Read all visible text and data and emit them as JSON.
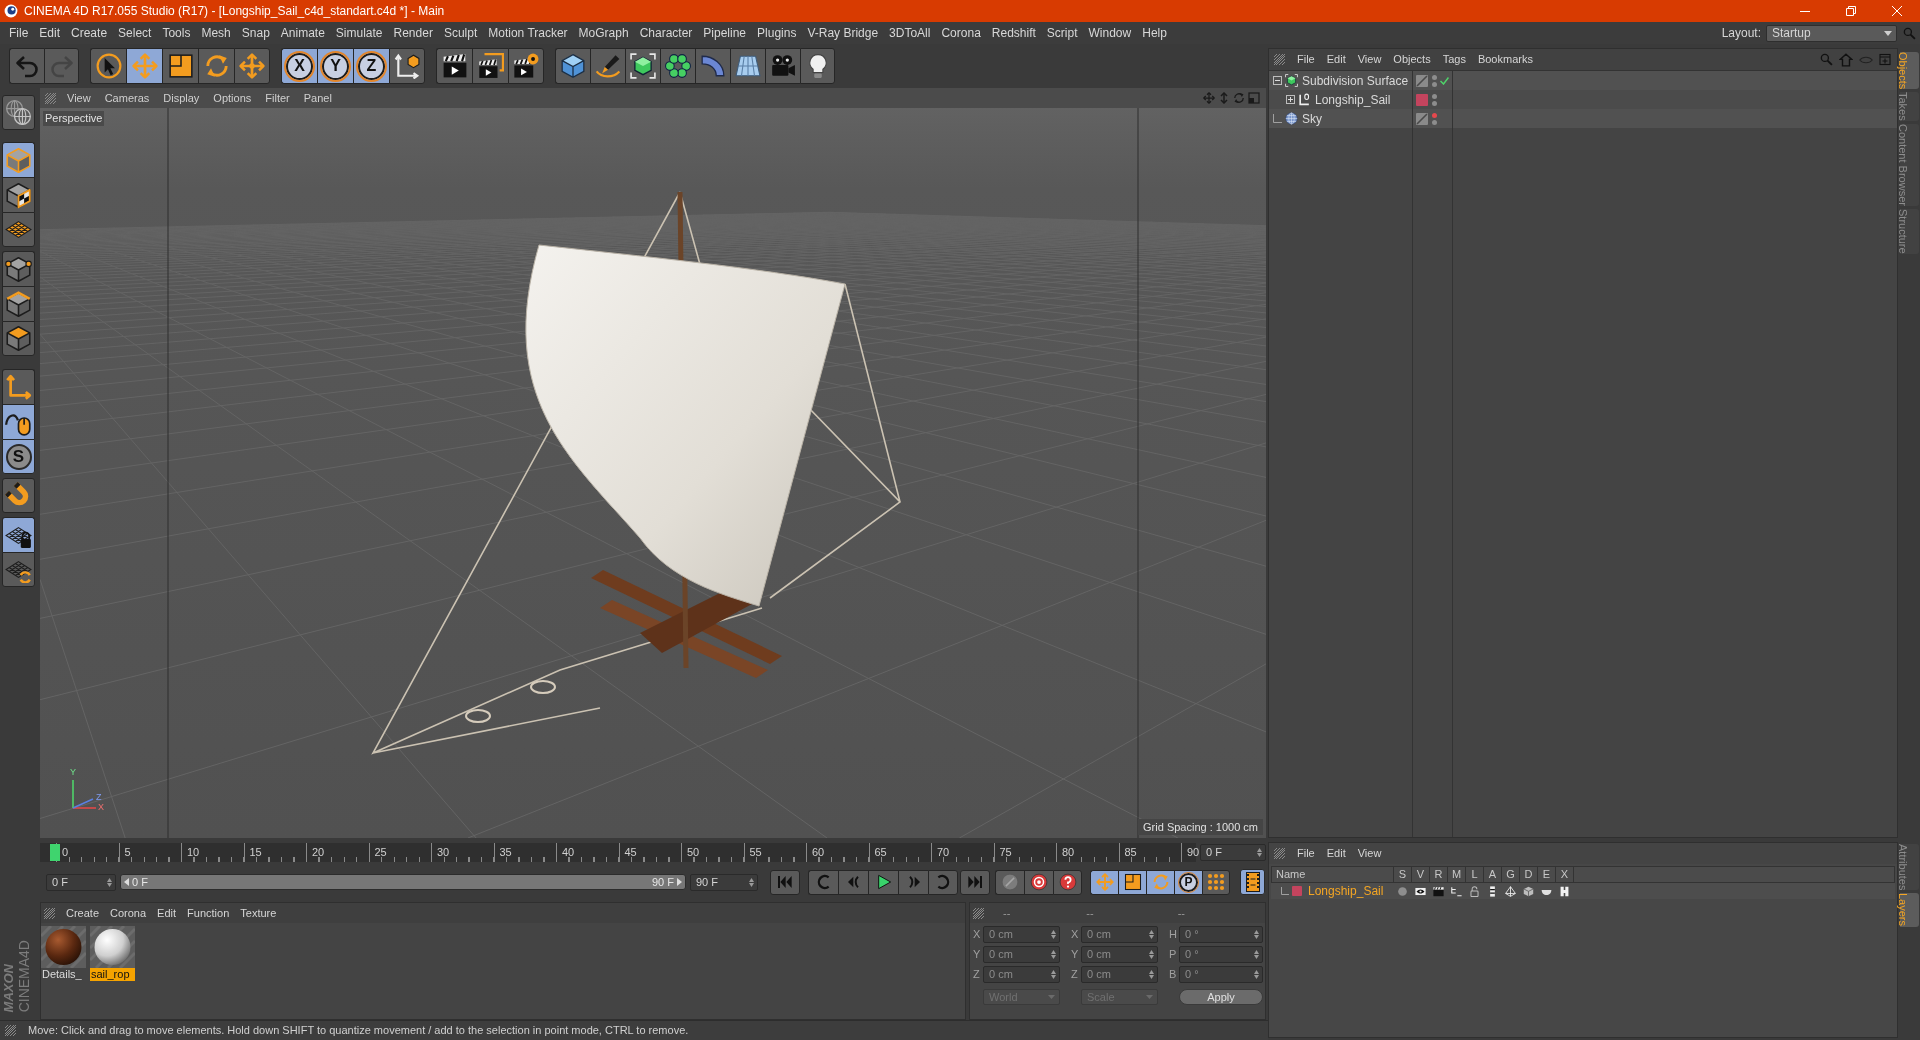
{
  "window": {
    "title": "CINEMA 4D R17.055 Studio (R17) - [Longship_Sail_c4d_standart.c4d *] - Main"
  },
  "menu_bar": {
    "items": [
      "File",
      "Edit",
      "Create",
      "Select",
      "Tools",
      "Mesh",
      "Snap",
      "Animate",
      "Simulate",
      "Render",
      "Sculpt",
      "Motion Tracker",
      "MoGraph",
      "Character",
      "Pipeline",
      "Plugins",
      "V-Ray Bridge",
      "3DToAll",
      "Corona",
      "Redshift",
      "Script",
      "Window",
      "Help"
    ],
    "layout_label": "Layout:",
    "layout_value": "Startup"
  },
  "toolbar": {
    "history": [
      {
        "disabled": false
      },
      {
        "disabled": true
      }
    ],
    "tools": [
      {
        "selected": false
      },
      {
        "selected": true
      },
      {
        "selected": false
      },
      {
        "selected": false
      },
      {
        "selected": false
      }
    ],
    "axis_locks": [
      {
        "label": "X",
        "selected": true
      },
      {
        "label": "Y",
        "selected": true
      },
      {
        "label": "Z",
        "selected": true
      }
    ],
    "coordinate_system": {
      "selected": false
    }
  },
  "mode_palette": [
    {
      "selected": false
    },
    {
      "selected": true
    },
    {
      "selected": false
    },
    {
      "selected": false
    },
    {
      "selected": false
    },
    {
      "selected": false
    },
    {
      "selected": false
    },
    {
      "selected": false
    },
    {
      "selected": true
    },
    {
      "label": "S",
      "selected": true
    },
    {
      "selected": false
    },
    {
      "selected": true
    },
    {
      "selected": false
    }
  ],
  "logo": {
    "wordmark": "MAXON",
    "product": "CINEMA4D"
  },
  "viewport": {
    "menu": [
      "View",
      "Cameras",
      "Display",
      "Options",
      "Filter",
      "Panel"
    ],
    "camera": "Perspective",
    "grid_spacing": "Grid Spacing : 1000 cm",
    "axis_labels": [
      "Y",
      "Z",
      "X"
    ]
  },
  "object_manager": {
    "menu": [
      "File",
      "Edit",
      "View",
      "Objects",
      "Tags",
      "Bookmarks"
    ],
    "objects": [
      {
        "name": "Subdivision Surface",
        "kind": "subdivision",
        "expanded": true,
        "enabled": true,
        "editor_hidden": false,
        "render_hidden": false,
        "children": [
          {
            "name": "Longship_Sail",
            "kind": "polygon",
            "expanded": false,
            "layer": {
              "color": "#c4445e"
            },
            "editor_hidden": false,
            "render_hidden": false
          }
        ]
      },
      {
        "name": "Sky",
        "kind": "sky",
        "editor_hidden": true,
        "render_hidden": false
      }
    ],
    "tabs": [
      {
        "label": "Objects",
        "selected": true
      },
      {
        "label": "Takes",
        "selected": false
      },
      {
        "label": "Content Browser",
        "selected": false
      },
      {
        "label": "Structure",
        "selected": false
      }
    ]
  },
  "timeline": {
    "ticks": [
      "0",
      "5",
      "10",
      "15",
      "20",
      "25",
      "30",
      "35",
      "40",
      "45",
      "50",
      "55",
      "60",
      "65",
      "70",
      "75",
      "80",
      "85",
      "90"
    ],
    "playhead": {
      "level": 0
    },
    "current_frame": "0 F",
    "start_frame": "0 F",
    "range_bar": {
      "start": "0 F",
      "end": "90 F"
    },
    "end_frame": "90 F",
    "key_modes": [
      {
        "selected": true
      },
      {
        "selected": true
      },
      {
        "selected": true
      },
      {
        "label": "P",
        "selected": true
      },
      {
        "selected": false
      }
    ],
    "timeline_toggle": {
      "selected": true
    }
  },
  "material_manager": {
    "menu": [
      "Create",
      "Corona",
      "Edit",
      "Function",
      "Texture"
    ],
    "materials": [
      {
        "name": "Details_",
        "kind": "wood",
        "selected": false
      },
      {
        "name": "sail_rop",
        "kind": "cloth",
        "selected": true
      }
    ]
  },
  "coordinates": {
    "headers": [
      "--",
      "--",
      "--"
    ],
    "rows": [
      {
        "axis": "X",
        "position": "0 cm",
        "size_axis": "X",
        "size": "0 cm",
        "rotation_axis": "H",
        "rotation": "0 °"
      },
      {
        "axis": "Y",
        "position": "0 cm",
        "size_axis": "Y",
        "size": "0 cm",
        "rotation_axis": "P",
        "rotation": "0 °"
      },
      {
        "axis": "Z",
        "position": "0 cm",
        "size_axis": "Z",
        "size": "0 cm",
        "rotation_axis": "B",
        "rotation": "0 °"
      }
    ],
    "space": {
      "value": "World",
      "disabled": true
    },
    "size_mode": {
      "value": "Scale",
      "disabled": true
    },
    "apply": "Apply"
  },
  "layer_manager": {
    "menu": [
      "File",
      "Edit",
      "View"
    ],
    "columns": [
      "Name",
      "S",
      "V",
      "R",
      "M",
      "L",
      "A",
      "G",
      "D",
      "E",
      "X"
    ],
    "layers": [
      {
        "name": "Longship_Sail",
        "color": "#c4445e"
      }
    ],
    "tabs": [
      {
        "label": "Attributes",
        "selected": false
      },
      {
        "label": "Layers",
        "selected": true
      }
    ]
  },
  "status_bar": {
    "text": "Move: Click and drag to move elements. Hold down SHIFT to quantize movement / add to the selection in point mode, CTRL to remove."
  }
}
